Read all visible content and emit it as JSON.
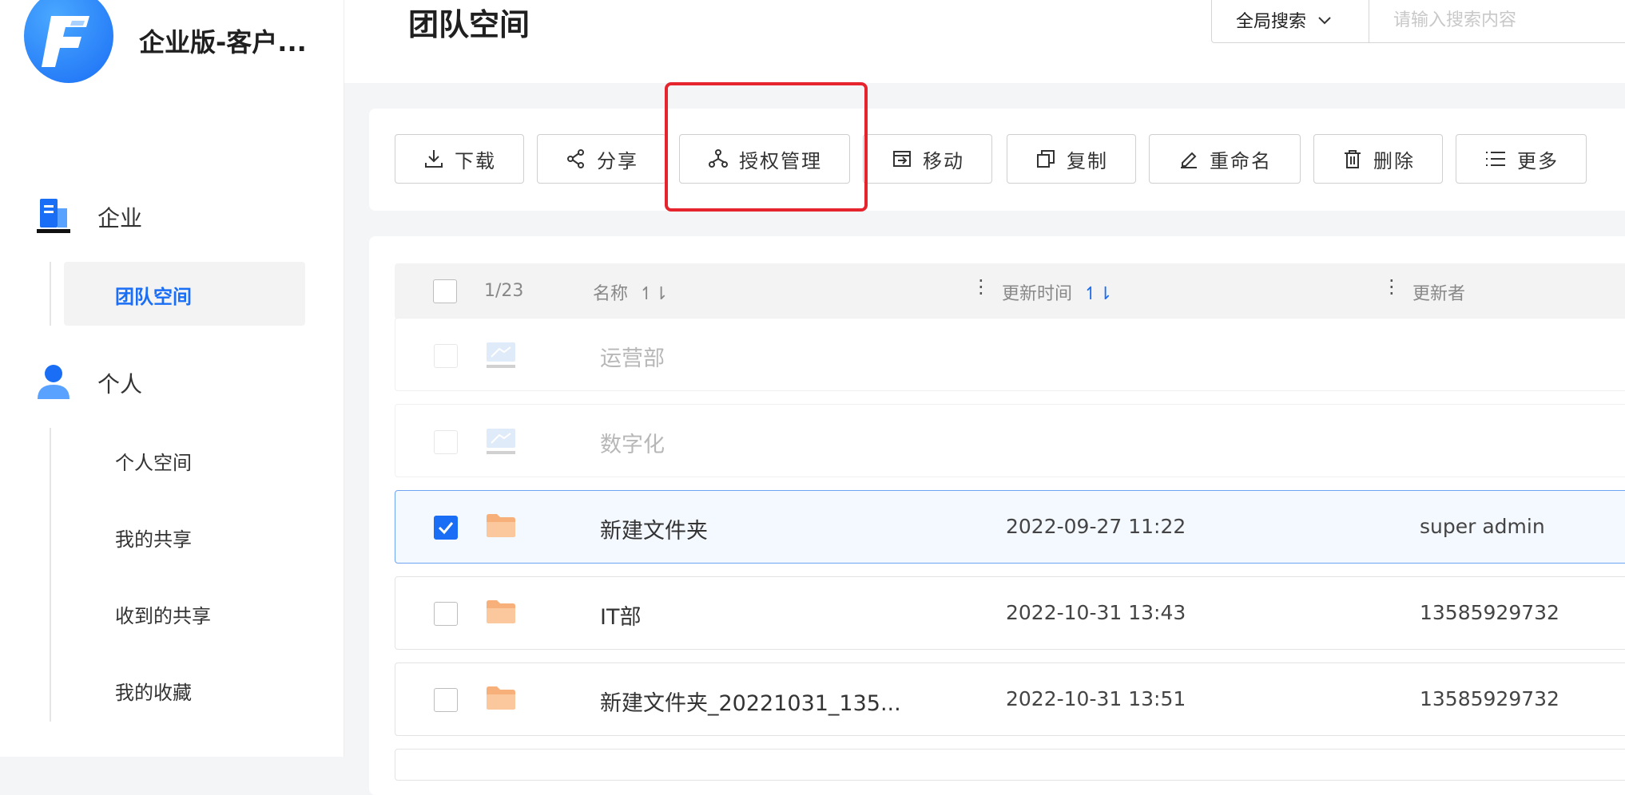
{
  "app": {
    "name": "企业版-客户..."
  },
  "sidebar": {
    "sections": [
      {
        "label": "企业",
        "icon": "building-icon"
      },
      {
        "label": "个人",
        "icon": "user-icon"
      }
    ],
    "enterprise_items": [
      {
        "label": "团队空间",
        "active": true
      }
    ],
    "personal_items": [
      {
        "label": "个人空间"
      },
      {
        "label": "我的共享"
      },
      {
        "label": "收到的共享"
      },
      {
        "label": "我的收藏"
      }
    ]
  },
  "header": {
    "title": "团队空间",
    "scope": "全局搜索",
    "search_placeholder": "请输入搜索内容"
  },
  "toolbar": {
    "download": "下载",
    "share": "分享",
    "permissions": "授权管理",
    "move": "移动",
    "copy": "复制",
    "rename": "重命名",
    "delete": "删除",
    "more": "更多"
  },
  "list": {
    "selection_count": "1/23",
    "columns": {
      "name": "名称",
      "updated": "更新时间",
      "updater": "更新者"
    },
    "sort_glyph": "↿⇂",
    "rows": [
      {
        "name": "运营部",
        "time": "",
        "user": "",
        "type": "drive",
        "checked": false
      },
      {
        "name": "数字化",
        "time": "",
        "user": "",
        "type": "drive",
        "checked": false
      },
      {
        "name": "新建文件夹",
        "time": "2022-09-27 11:22",
        "user": "super admin",
        "type": "folder",
        "checked": true
      },
      {
        "name": "IT部",
        "time": "2022-10-31 13:43",
        "user": "13585929732",
        "type": "folder",
        "checked": false
      },
      {
        "name": "新建文件夹_20221031_135...",
        "time": "2022-10-31 13:51",
        "user": "13585929732",
        "type": "folder",
        "checked": false
      }
    ]
  },
  "colors": {
    "accent": "#1a6ef5",
    "highlight": "#e5242d",
    "folder": "#f7b07a"
  }
}
